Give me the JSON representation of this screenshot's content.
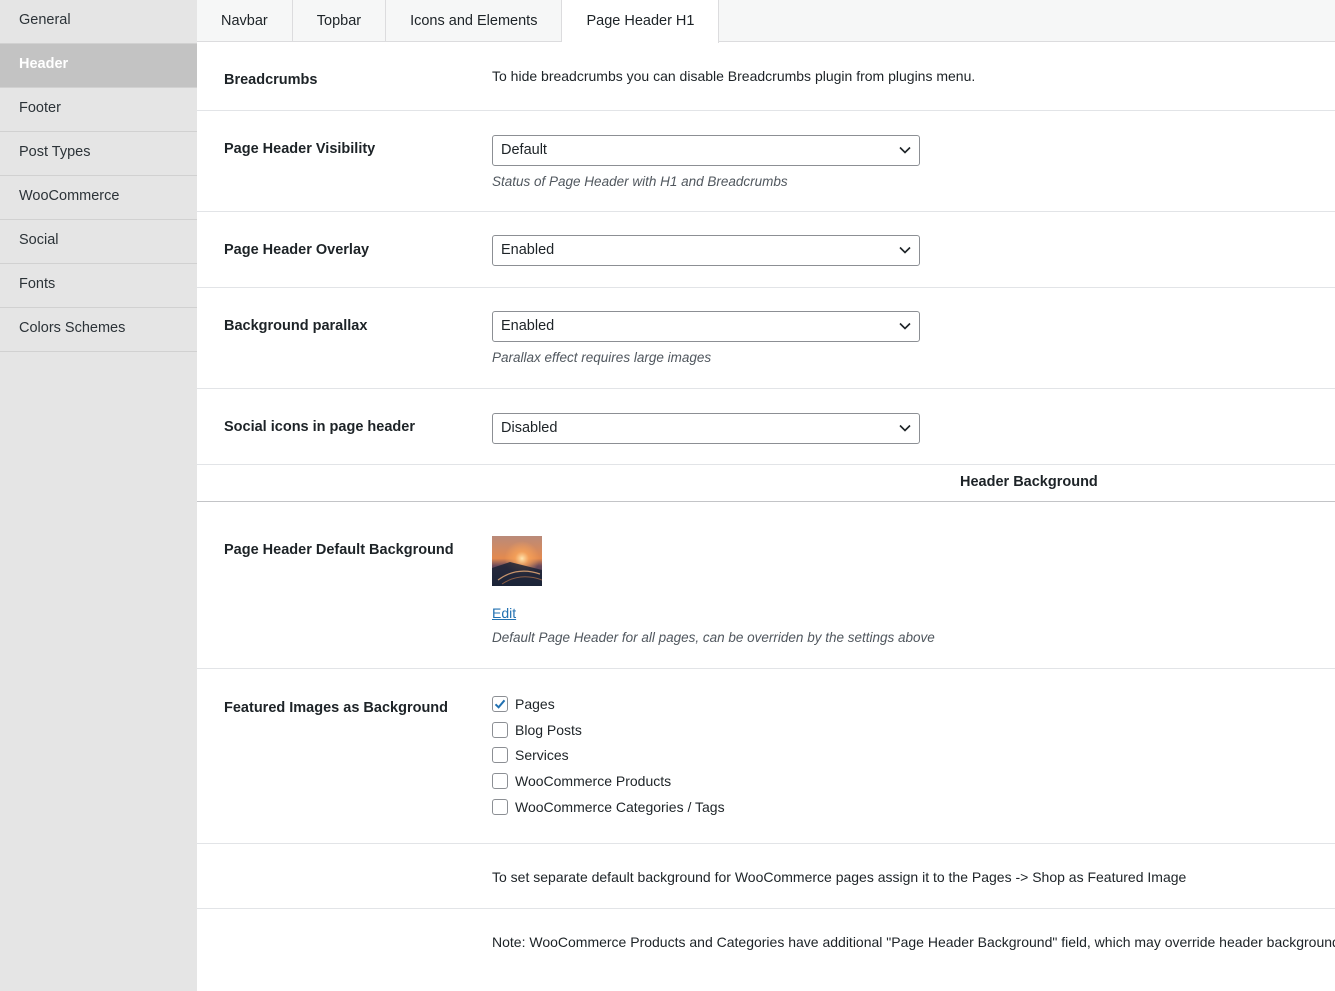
{
  "sidebar": {
    "items": [
      {
        "label": "General",
        "active": false
      },
      {
        "label": "Header",
        "active": true
      },
      {
        "label": "Footer",
        "active": false
      },
      {
        "label": "Post Types",
        "active": false
      },
      {
        "label": "WooCommerce",
        "active": false
      },
      {
        "label": "Social",
        "active": false
      },
      {
        "label": "Fonts",
        "active": false
      },
      {
        "label": "Colors Schemes",
        "active": false
      }
    ]
  },
  "tabs": [
    {
      "label": "Navbar",
      "active": false
    },
    {
      "label": "Topbar",
      "active": false
    },
    {
      "label": "Icons and Elements",
      "active": false
    },
    {
      "label": "Page Header H1",
      "active": true
    }
  ],
  "settings": {
    "breadcrumbs": {
      "label": "Breadcrumbs",
      "text": "To hide breadcrumbs you can disable Breadcrumbs plugin from plugins menu."
    },
    "visibility": {
      "label": "Page Header Visibility",
      "value": "Default",
      "description": "Status of Page Header with H1 and Breadcrumbs"
    },
    "overlay": {
      "label": "Page Header Overlay",
      "value": "Enabled"
    },
    "parallax": {
      "label": "Background parallax",
      "value": "Enabled",
      "description": "Parallax effect requires large images"
    },
    "social": {
      "label": "Social icons in page header",
      "value": "Disabled"
    }
  },
  "background_section": {
    "heading": "Header Background",
    "default_bg": {
      "label": "Page Header Default Background",
      "edit_label": "Edit",
      "description": "Default Page Header for all pages, can be overriden by the settings above"
    },
    "featured": {
      "label": "Featured Images as Background",
      "options": [
        {
          "label": "Pages",
          "checked": true
        },
        {
          "label": "Blog Posts",
          "checked": false
        },
        {
          "label": "Services",
          "checked": false
        },
        {
          "label": "WooCommerce Products",
          "checked": false
        },
        {
          "label": "WooCommerce Categories / Tags",
          "checked": false
        }
      ]
    },
    "note_shop": "To set separate default background for WooCommerce pages assign it to the Pages -> Shop as Featured Image",
    "note_override": "Note: WooCommerce Products and Categories have additional \"Page Header Background\" field, which may override header background"
  },
  "colors": {
    "accent": "#2271b1",
    "sidebar_bg": "#e5e5e5",
    "sidebar_active": "#c3c3c3"
  }
}
